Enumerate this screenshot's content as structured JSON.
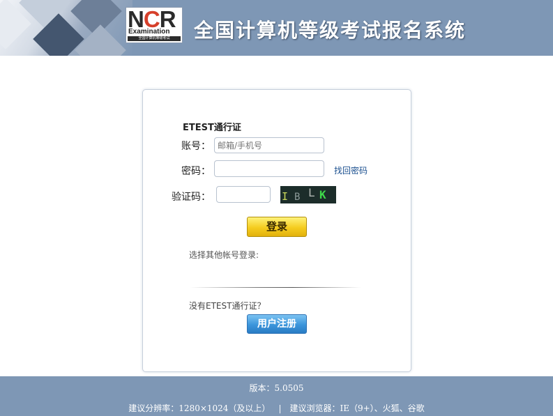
{
  "header": {
    "logo_letters": "NCR",
    "logo_sub": "Examination",
    "logo_tiny": "全国计算机等级考试",
    "title": "全国计算机等级考试报名系统"
  },
  "login": {
    "section_title": "ETEST通行证",
    "account_label": "账号：",
    "account_placeholder": "邮箱/手机号",
    "password_label": "密码：",
    "forgot_link": "找回密码",
    "captcha_label": "验证码：",
    "captcha_chars": [
      "I",
      "B",
      "L",
      "K"
    ],
    "login_button": "登录",
    "other_accounts": "选择其他帐号登录:",
    "no_account": "没有ETEST通行证？",
    "register_button": "用户注册"
  },
  "footer": {
    "version": "版本：5.0505",
    "resolution": "建议分辨率：1280×1024（及以上）",
    "separator": "|",
    "browsers": "建议浏览器：IE（9+）、火狐、谷歌"
  },
  "colors": {
    "header_bg": "#7e97b5",
    "footer_bg": "#7e97b5",
    "login_button": "#f5cc1f",
    "register_button": "#3b95db",
    "link": "#1a4f8f"
  }
}
